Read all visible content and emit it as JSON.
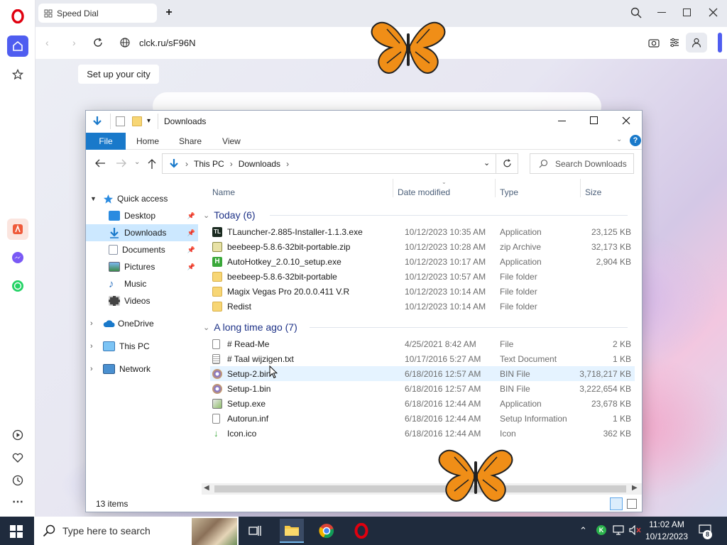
{
  "browser": {
    "tab_title": "Speed Dial",
    "url": "clck.ru/sF96N",
    "city_prompt": "Set up your city"
  },
  "explorer": {
    "window_title": "Downloads",
    "ribbon_tabs": [
      "File",
      "Home",
      "Share",
      "View"
    ],
    "breadcrumb": [
      "This PC",
      "Downloads"
    ],
    "search_placeholder": "Search Downloads",
    "nav": {
      "quick_access": "Quick access",
      "desktop": "Desktop",
      "downloads": "Downloads",
      "documents": "Documents",
      "pictures": "Pictures",
      "music": "Music",
      "videos": "Videos",
      "onedrive": "OneDrive",
      "thispc": "This PC",
      "network": "Network"
    },
    "columns": {
      "name": "Name",
      "date": "Date modified",
      "type": "Type",
      "size": "Size"
    },
    "group_today": "Today (6)",
    "group_old": "A long time ago (7)",
    "files_today": [
      {
        "name": "TLauncher-2.885-Installer-1.1.3.exe",
        "date": "10/12/2023 10:35 AM",
        "type": "Application",
        "size": "23,125 KB"
      },
      {
        "name": "beebeep-5.8.6-32bit-portable.zip",
        "date": "10/12/2023 10:28 AM",
        "type": "zip Archive",
        "size": "32,173 KB"
      },
      {
        "name": "AutoHotkey_2.0.10_setup.exe",
        "date": "10/12/2023 10:17 AM",
        "type": "Application",
        "size": "2,904 KB"
      },
      {
        "name": "beebeep-5.8.6-32bit-portable",
        "date": "10/12/2023 10:57 AM",
        "type": "File folder",
        "size": ""
      },
      {
        "name": "Magix Vegas Pro 20.0.0.411 V.R",
        "date": "10/12/2023 10:14 AM",
        "type": "File folder",
        "size": ""
      },
      {
        "name": "Redist",
        "date": "10/12/2023 10:14 AM",
        "type": "File folder",
        "size": ""
      }
    ],
    "files_old": [
      {
        "name": "# Read-Me",
        "date": "4/25/2021 8:42 AM",
        "type": "File",
        "size": "2 KB"
      },
      {
        "name": "# Taal wijzigen.txt",
        "date": "10/17/2016 5:27 AM",
        "type": "Text Document",
        "size": "1 KB"
      },
      {
        "name": "Setup-2.bin",
        "date": "6/18/2016 12:57 AM",
        "type": "BIN File",
        "size": "3,718,217 KB"
      },
      {
        "name": "Setup-1.bin",
        "date": "6/18/2016 12:57 AM",
        "type": "BIN File",
        "size": "3,222,654 KB"
      },
      {
        "name": "Setup.exe",
        "date": "6/18/2016 12:44 AM",
        "type": "Application",
        "size": "23,678 KB"
      },
      {
        "name": "Autorun.inf",
        "date": "6/18/2016 12:44 AM",
        "type": "Setup Information",
        "size": "1 KB"
      },
      {
        "name": "Icon.ico",
        "date": "6/18/2016 12:44 AM",
        "type": "Icon",
        "size": "362 KB"
      }
    ],
    "status": "13 items"
  },
  "taskbar": {
    "search_placeholder": "Type here to search",
    "time": "11:02 AM",
    "date": "10/12/2023",
    "notif_count": "8"
  },
  "colors": {
    "accent": "#1979ca",
    "opera_red": "#e0000f",
    "sidebar_active": "#4f5df0"
  }
}
